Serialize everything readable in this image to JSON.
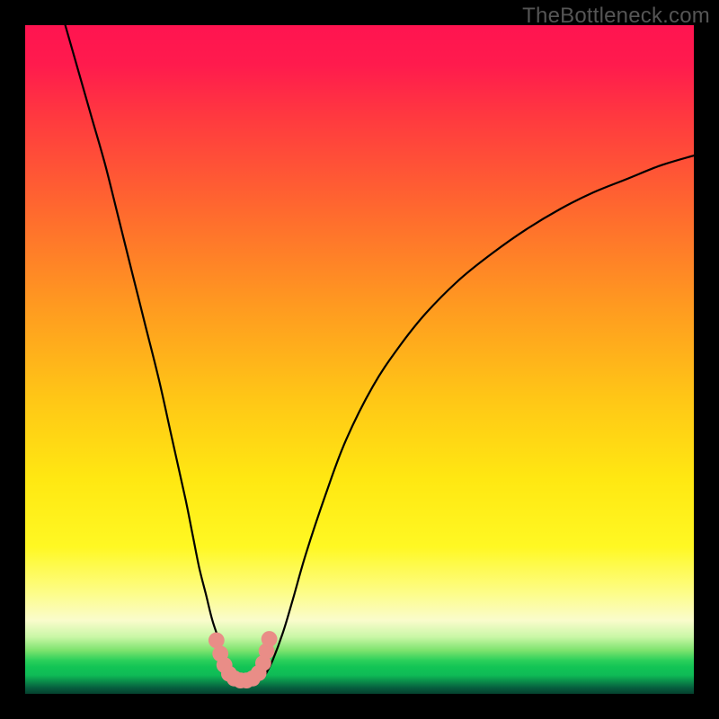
{
  "watermark": "TheBottleneck.com",
  "chart_data": {
    "type": "line",
    "title": "",
    "xlabel": "",
    "ylabel": "",
    "xlim": [
      0,
      100
    ],
    "ylim": [
      0,
      100
    ],
    "grid": false,
    "legend": false,
    "background": {
      "type": "vertical-gradient",
      "stops": [
        {
          "pos": 0,
          "color": "#ff1450"
        },
        {
          "pos": 28,
          "color": "#ff6a2e"
        },
        {
          "pos": 56,
          "color": "#ffc716"
        },
        {
          "pos": 85,
          "color": "#fafccc"
        },
        {
          "pos": 95,
          "color": "#2bd05b"
        },
        {
          "pos": 100,
          "color": "#05412e"
        }
      ]
    },
    "series": [
      {
        "name": "left-branch",
        "stroke": "#000000",
        "x": [
          6,
          8,
          10,
          12,
          14,
          16,
          18,
          20,
          22,
          24,
          25,
          26,
          27,
          28,
          29,
          30,
          30.7
        ],
        "y": [
          100,
          93,
          86,
          79,
          71,
          63,
          55,
          47,
          38,
          29,
          24,
          19,
          15,
          11,
          8,
          5,
          3
        ]
      },
      {
        "name": "right-branch",
        "stroke": "#000000",
        "x": [
          36,
          37,
          38.5,
          40,
          42,
          45,
          48,
          52,
          56,
          60,
          65,
          70,
          75,
          80,
          85,
          90,
          95,
          100
        ],
        "y": [
          3,
          5,
          9,
          14,
          21,
          30,
          38,
          46,
          52,
          57,
          62,
          66,
          69.5,
          72.5,
          75,
          77,
          79,
          80.5
        ]
      },
      {
        "name": "trough-markers",
        "type": "scatter",
        "marker_color": "#e98d87",
        "marker_radius": 1.2,
        "x": [
          28.6,
          29.2,
          29.8,
          30.5,
          31.3,
          32.2,
          33.1,
          34.0,
          34.9,
          35.6,
          36.1,
          36.5
        ],
        "y": [
          8.0,
          6.0,
          4.3,
          3.0,
          2.3,
          2.0,
          2.0,
          2.3,
          3.1,
          4.6,
          6.4,
          8.2
        ]
      }
    ],
    "annotations": [
      {
        "text": "TheBottleneck.com",
        "anchor": "top-right",
        "color": "#555555"
      }
    ]
  }
}
